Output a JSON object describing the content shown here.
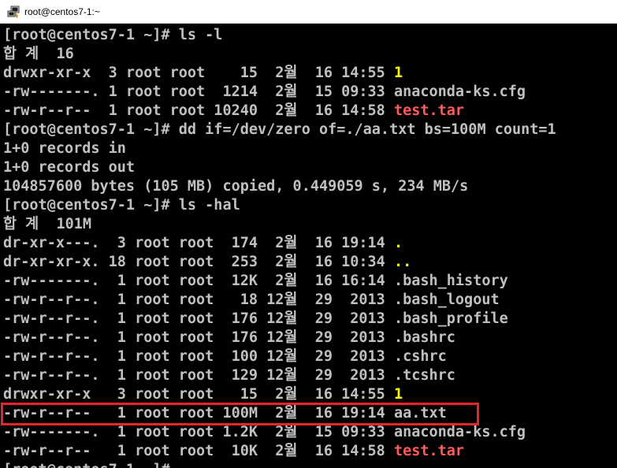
{
  "window": {
    "title": "root@centos7-1:~",
    "icon": "putty-terminal-icon"
  },
  "colors": {
    "foreground": "#c0c0c0",
    "background": "#000000",
    "directory": "#ffff00",
    "archive": "#ff5a5a",
    "highlight": "#e8232a"
  },
  "terminal": {
    "lines": [
      {
        "text": "[root@centos7-1 ~]# ls -l"
      },
      {
        "text": "합 계  16"
      },
      {
        "text": "drwxr-xr-x  3 root root    15  2월  16 14:55 ",
        "name": "1",
        "color": "yellow"
      },
      {
        "text": "-rw-------. 1 root root  1214  2월  15 09:33 anaconda-ks.cfg"
      },
      {
        "text": "-rw-r--r--  1 root root 10240  2월  16 14:58 ",
        "name": "test.tar",
        "color": "red"
      },
      {
        "text": "[root@centos7-1 ~]# dd if=/dev/zero of=./aa.txt bs=100M count=1"
      },
      {
        "text": "1+0 records in"
      },
      {
        "text": "1+0 records out"
      },
      {
        "text": "104857600 bytes (105 MB) copied, 0.449059 s, 234 MB/s"
      },
      {
        "text": "[root@centos7-1 ~]# ls -hal"
      },
      {
        "text": "합 계  101M"
      },
      {
        "text": "dr-xr-x---.  3 root root  174  2월  16 19:14 ",
        "name": ".",
        "color": "yellow"
      },
      {
        "text": "dr-xr-xr-x. 18 root root  253  2월  16 10:34 ",
        "name": "..",
        "color": "yellow"
      },
      {
        "text": "-rw-------.  1 root root  12K  2월  16 16:14 .bash_history"
      },
      {
        "text": "-rw-r--r--.  1 root root   18 12월  29  2013 .bash_logout"
      },
      {
        "text": "-rw-r--r--.  1 root root  176 12월  29  2013 .bash_profile"
      },
      {
        "text": "-rw-r--r--.  1 root root  176 12월  29  2013 .bashrc"
      },
      {
        "text": "-rw-r--r--.  1 root root  100 12월  29  2013 .cshrc"
      },
      {
        "text": "-rw-r--r--.  1 root root  129 12월  29  2013 .tcshrc"
      },
      {
        "text": "drwxr-xr-x   3 root root   15  2월  16 14:55 ",
        "name": "1",
        "color": "yellow"
      },
      {
        "text": "-rw-r--r--   1 root root 100M  2월  16 19:14 aa.txt"
      },
      {
        "text": "-rw-------.  1 root root 1.2K  2월  15 09:33 anaconda-ks.cfg"
      },
      {
        "text": "-rw-r--r--   1 root root  10K  2월  16 14:58 ",
        "name": "test.tar",
        "color": "red"
      },
      {
        "text": "[root@centos7-1 ~]#"
      }
    ]
  }
}
